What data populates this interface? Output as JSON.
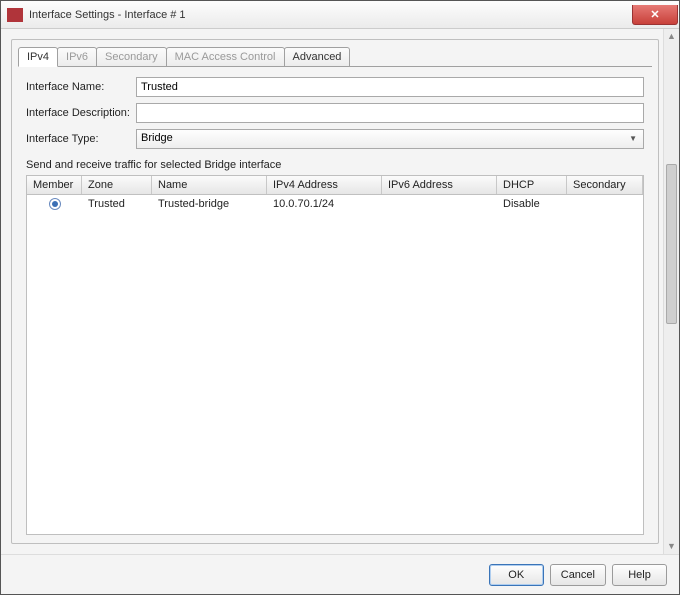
{
  "window": {
    "title": "Interface Settings - Interface # 1"
  },
  "tabs": {
    "ipv4": "IPv4",
    "ipv6": "IPv6",
    "secondary": "Secondary",
    "mac": "MAC Access Control",
    "advanced": "Advanced"
  },
  "form": {
    "name_label": "Interface Name:",
    "name_value": "Trusted",
    "desc_label": "Interface Description:",
    "desc_value": "",
    "type_label": "Interface Type:",
    "type_value": "Bridge"
  },
  "section": {
    "caption": "Send and receive traffic for selected Bridge interface"
  },
  "table": {
    "headers": {
      "member": "Member",
      "zone": "Zone",
      "name": "Name",
      "ipv4": "IPv4 Address",
      "ipv6": "IPv6 Address",
      "dhcp": "DHCP",
      "secondary": "Secondary"
    },
    "rows": [
      {
        "selected": true,
        "zone": "Trusted",
        "name": "Trusted-bridge",
        "ipv4": "10.0.70.1/24",
        "ipv6": "",
        "dhcp": "Disable",
        "secondary": ""
      }
    ]
  },
  "buttons": {
    "ok": "OK",
    "cancel": "Cancel",
    "help": "Help"
  }
}
